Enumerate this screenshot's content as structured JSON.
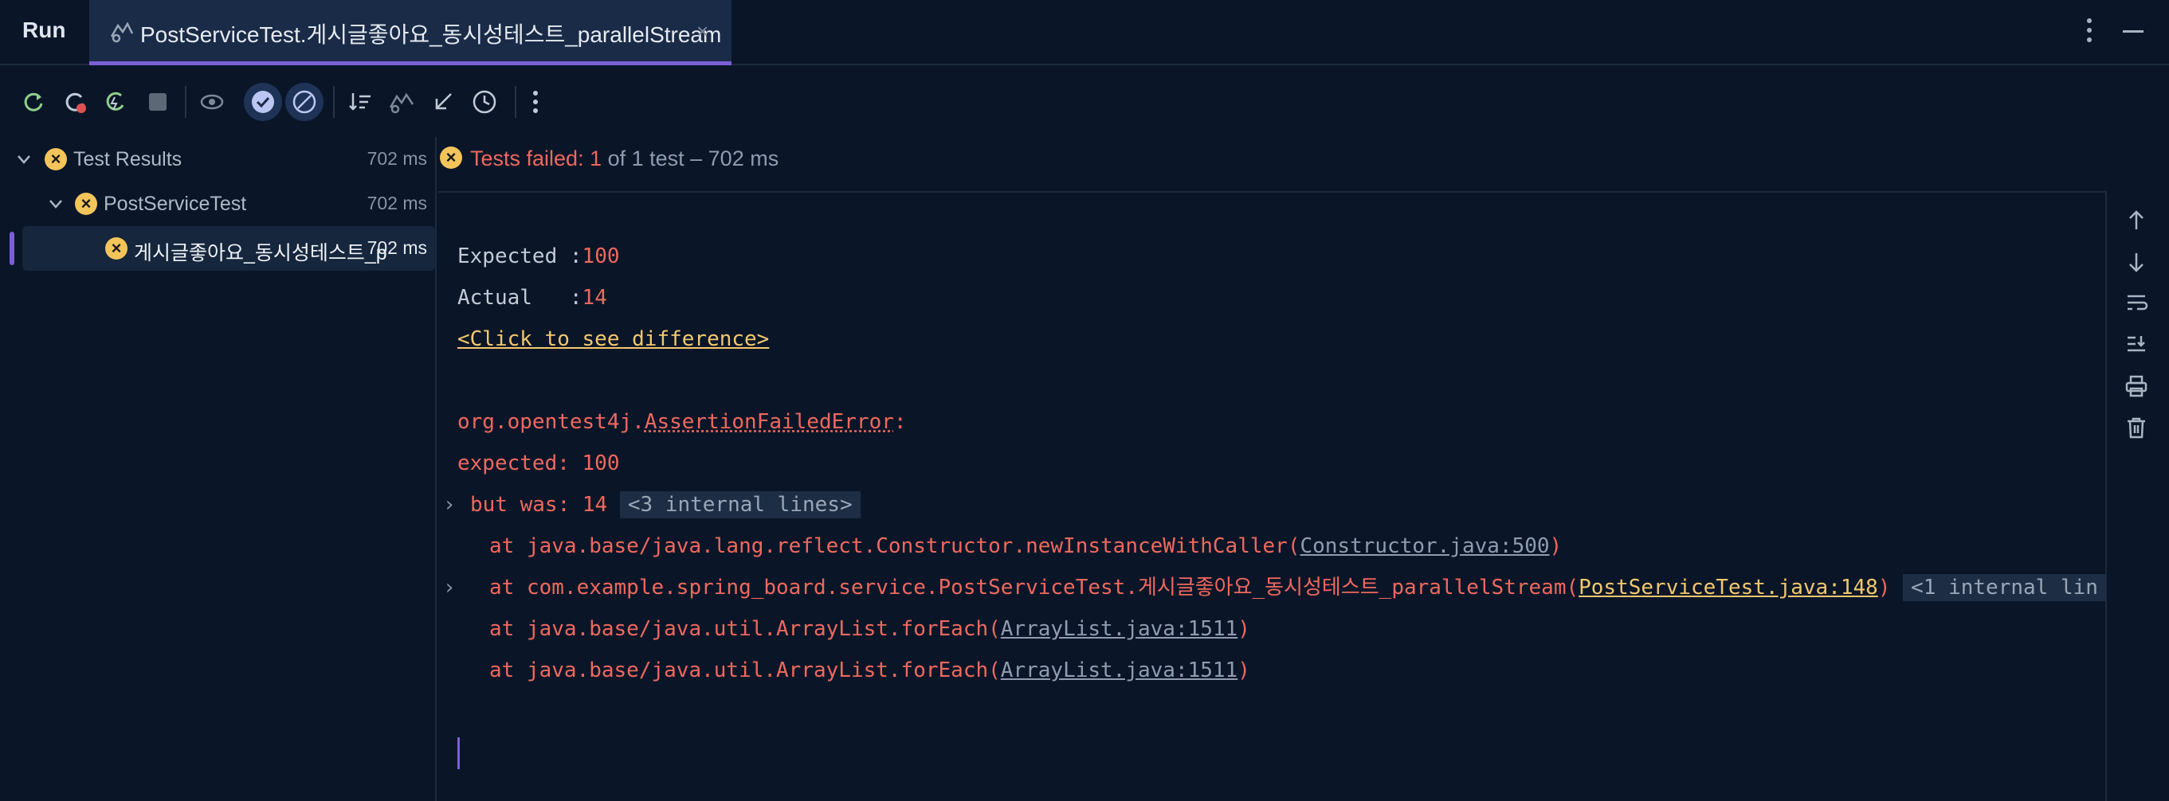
{
  "window": {
    "run_label": "Run"
  },
  "tab": {
    "title": "PostServiceTest.게시글좋아요_동시성테스트_parallelStream",
    "close_glyph": "×",
    "icon": "test-run-icon"
  },
  "toolbar": {
    "buttons": [
      {
        "name": "rerun-icon"
      },
      {
        "name": "rerun-failed-icon"
      },
      {
        "name": "toggle-auto-test-icon"
      },
      {
        "name": "stop-icon"
      },
      {
        "name": "show-ignored-icon"
      },
      {
        "name": "show-passed-icon"
      },
      {
        "name": "show-ignored-toggle-icon"
      },
      {
        "name": "sort-icon"
      },
      {
        "name": "collapse-icon"
      },
      {
        "name": "import-tests-icon"
      },
      {
        "name": "history-icon"
      },
      {
        "name": "more-icon"
      }
    ]
  },
  "tree": {
    "root": {
      "label": "Test Results",
      "time": "702 ms"
    },
    "class": {
      "label": "PostServiceTest",
      "time": "702 ms"
    },
    "method": {
      "label": "게시글좋아요_동시성테스트_p",
      "time": "702 ms"
    }
  },
  "status": {
    "prefix": "Tests failed: 1",
    "suffix": " of 1 test – 702 ms"
  },
  "console": {
    "expected_label": "Expected :",
    "expected_value": "100",
    "actual_label": "Actual   :",
    "actual_value": "14",
    "diff_link": "<Click to see difference>",
    "error_pkg": "org.opentest4j.",
    "error_class": "AssertionFailedError",
    "error_colon": ":",
    "expected_line": "expected: 100",
    "but_was": "but was: 14",
    "internal_3": "<3 internal lines>",
    "trace1_prefix": "at java.base/java.lang.reflect.Constructor.newInstanceWithCaller(",
    "trace1_link": "Constructor.java:500",
    "trace1_suffix": ")",
    "trace2_prefix": "at com.example.spring_board.service.PostServiceTest.게시글좋아요_동시성테스트_parallelStream(",
    "trace2_link": "PostServiceTest.java:148",
    "trace2_suffix": ")",
    "internal_1": "<1 internal lin",
    "trace3_prefix": "at java.base/java.util.ArrayList.forEach(",
    "trace3_link": "ArrayList.java:1511",
    "trace3_suffix": ")",
    "trace4_prefix": "at java.base/java.util.ArrayList.forEach(",
    "trace4_link": "ArrayList.java:1511",
    "trace4_suffix": ")"
  },
  "colors": {
    "background": "#0a1628",
    "error_red": "#f0685e",
    "fail_yellow": "#f2c45a",
    "accent_purple": "#7c5fd6",
    "link_yellow": "#f2c86e"
  }
}
